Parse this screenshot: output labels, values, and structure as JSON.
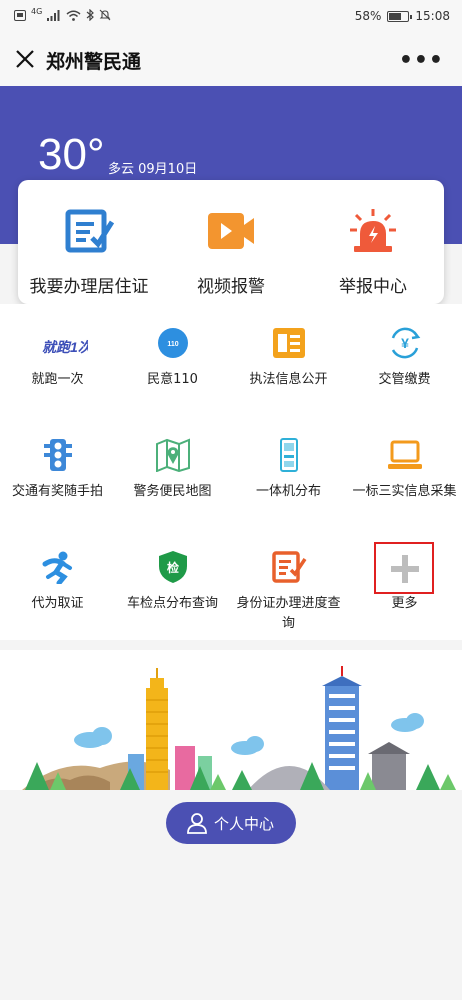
{
  "status_bar": {
    "network": "4G",
    "battery": "58%",
    "battery_level": 0.58,
    "time": "15:08"
  },
  "header": {
    "title": "郑州警民通",
    "close_icon": "close-icon",
    "more_icon": "more-dots-icon"
  },
  "weather": {
    "temperature": "30°",
    "condition_date": "多云 09月10日"
  },
  "quick_actions": [
    {
      "label": "我要办理居住证",
      "icon": "form-edit-icon",
      "color": "#2f7fd0"
    },
    {
      "label": "视频报警",
      "icon": "video-camera-icon",
      "color": "#f3952f"
    },
    {
      "label": "举报中心",
      "icon": "alarm-siren-icon",
      "color": "#ef5a3a"
    }
  ],
  "services": [
    {
      "label": "就跑一次",
      "icon": "run-once-logo-icon"
    },
    {
      "label": "民意110",
      "icon": "opinion-110-icon"
    },
    {
      "label": "执法信息公开",
      "icon": "info-card-icon"
    },
    {
      "label": "交管缴费",
      "icon": "yuan-exchange-icon"
    },
    {
      "label": "交通有奖随手拍",
      "icon": "traffic-light-icon"
    },
    {
      "label": "警务便民地图",
      "icon": "map-pin-icon"
    },
    {
      "label": "一体机分布",
      "icon": "kiosk-icon"
    },
    {
      "label": "一标三实信息采集",
      "icon": "laptop-icon"
    },
    {
      "label": "代为取证",
      "icon": "running-man-icon"
    },
    {
      "label": "车检点分布查询",
      "icon": "inspection-shield-icon"
    },
    {
      "label": "身份证办理进度查询",
      "icon": "id-form-edit-icon"
    },
    {
      "label": "更多",
      "icon": "plus-icon"
    }
  ],
  "run_once_logo_text": "就跑1次",
  "shield_text": "检",
  "profile_button": {
    "label": "个人中心",
    "icon": "person-icon"
  }
}
